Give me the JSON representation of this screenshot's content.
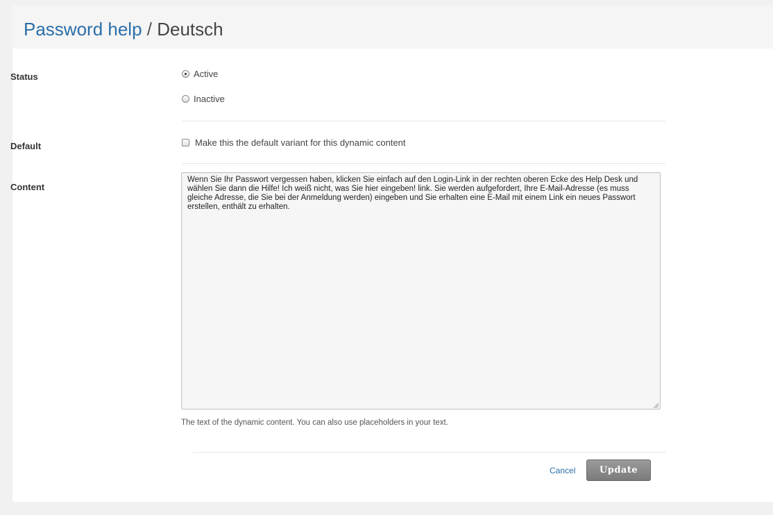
{
  "header": {
    "title_link": "Password help",
    "separator": " / ",
    "title_current": "Deutsch"
  },
  "status": {
    "label": "Status",
    "options": [
      {
        "label": "Active",
        "selected": true
      },
      {
        "label": "Inactive",
        "selected": false
      }
    ]
  },
  "default": {
    "label": "Default",
    "checkbox_label": "Make this the default variant for this dynamic content",
    "checked": false
  },
  "content": {
    "label": "Content",
    "value": "Wenn Sie Ihr Passwort vergessen haben, klicken Sie einfach auf den Login-Link in der rechten oberen Ecke des Help Desk und wählen Sie dann die Hilfe! Ich weiß nicht, was Sie hier eingeben! link. Sie werden aufgefordert, Ihre E-Mail-Adresse (es muss gleiche Adresse, die Sie bei der Anmeldung werden) eingeben und Sie erhalten eine E-Mail mit einem Link ein neues Passwort erstellen, enthält zu erhalten.",
    "help_text": "The text of the dynamic content. You can also use placeholders in your text."
  },
  "actions": {
    "cancel_label": "Cancel",
    "update_label": "Update"
  },
  "colors": {
    "link": "#2b6ea8",
    "button_bg": "#8a8a8a"
  }
}
